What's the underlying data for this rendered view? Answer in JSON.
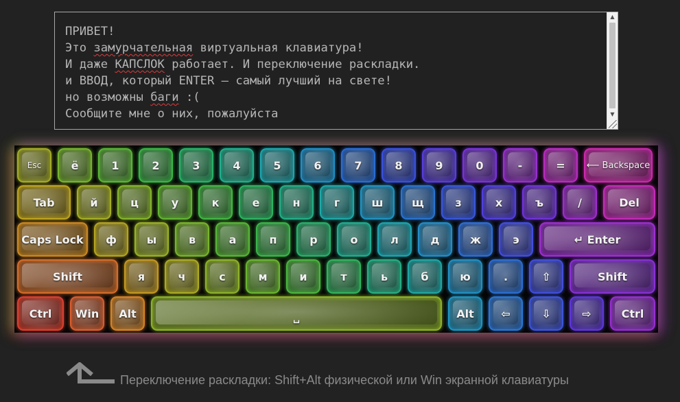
{
  "textarea": {
    "lines": [
      [
        {
          "t": "ПРИВЕТ!"
        }
      ],
      [
        {
          "t": "Это "
        },
        {
          "t": "замурчательная",
          "m": true
        },
        {
          "t": " виртуальная клавиатура!"
        }
      ],
      [
        {
          "t": "И даже "
        },
        {
          "t": "КАПСЛОК",
          "m": true
        },
        {
          "t": " работает. И переключение раскладки."
        }
      ],
      [
        {
          "t": "и ВВОД, который ENTER — самый лучший на свете!"
        }
      ],
      [
        {
          "t": "но возможны "
        },
        {
          "t": "баги",
          "m": true
        },
        {
          "t": " :("
        }
      ],
      [
        {
          "t": "Сообщите мне о них, пожалуйста"
        }
      ]
    ],
    "scroll_up_icon": "▲",
    "scroll_down_icon": "▼"
  },
  "keyboard": {
    "rows": [
      [
        {
          "label": "Esc",
          "name": "key-esc",
          "color": "#a8b028",
          "style": "small"
        },
        {
          "label": "ё",
          "name": "key-yo",
          "color": "#78b830"
        },
        {
          "label": "1",
          "name": "key-1",
          "color": "#5cb838"
        },
        {
          "label": "2",
          "name": "key-2",
          "color": "#3cb848"
        },
        {
          "label": "3",
          "name": "key-3",
          "color": "#2ab66a"
        },
        {
          "label": "4",
          "name": "key-4",
          "color": "#22b290"
        },
        {
          "label": "5",
          "name": "key-5",
          "color": "#1eaab0"
        },
        {
          "label": "6",
          "name": "key-6",
          "color": "#2090c8"
        },
        {
          "label": "7",
          "name": "key-7",
          "color": "#2a6ed8"
        },
        {
          "label": "8",
          "name": "key-8",
          "color": "#3a52e0"
        },
        {
          "label": "9",
          "name": "key-9",
          "color": "#5a3ee0"
        },
        {
          "label": "0",
          "name": "key-0",
          "color": "#7a34dc"
        },
        {
          "label": "-",
          "name": "key-minus",
          "color": "#9a30d4"
        },
        {
          "label": "=",
          "name": "key-equals",
          "color": "#bc2cc4"
        },
        {
          "label": "⟵ Backspace",
          "name": "key-backspace",
          "color": "#d02ab0",
          "style": "tiny"
        }
      ],
      [
        {
          "label": "Tab",
          "name": "key-tab",
          "color": "#c2a820"
        },
        {
          "label": "й",
          "name": "key-y-short",
          "color": "#a8b226"
        },
        {
          "label": "ц",
          "name": "key-ts",
          "color": "#86b82c"
        },
        {
          "label": "у",
          "name": "key-u",
          "color": "#64b834"
        },
        {
          "label": "к",
          "name": "key-k",
          "color": "#44b844"
        },
        {
          "label": "е",
          "name": "key-ye",
          "color": "#2eb662"
        },
        {
          "label": "н",
          "name": "key-n",
          "color": "#24b288"
        },
        {
          "label": "г",
          "name": "key-g",
          "color": "#1eacac"
        },
        {
          "label": "ш",
          "name": "key-sh",
          "color": "#2096c4"
        },
        {
          "label": "щ",
          "name": "key-shch",
          "color": "#2876d4"
        },
        {
          "label": "з",
          "name": "key-z",
          "color": "#3858de"
        },
        {
          "label": "х",
          "name": "key-kh",
          "color": "#5240e0"
        },
        {
          "label": "ъ",
          "name": "key-hard-sign",
          "color": "#7234dc"
        },
        {
          "label": "/",
          "name": "key-slash",
          "color": "#a02ed0"
        },
        {
          "label": "Del",
          "name": "key-del",
          "color": "#c82cbc"
        }
      ],
      [
        {
          "label": "Caps Lock",
          "name": "key-caps-lock",
          "color": "#d08c22"
        },
        {
          "label": "ф",
          "name": "key-f",
          "color": "#b8a822"
        },
        {
          "label": "ы",
          "name": "key-yery",
          "color": "#9cb428"
        },
        {
          "label": "в",
          "name": "key-v",
          "color": "#7ab82e"
        },
        {
          "label": "а",
          "name": "key-a",
          "color": "#58b838"
        },
        {
          "label": "п",
          "name": "key-p",
          "color": "#3cb84c"
        },
        {
          "label": "р",
          "name": "key-r",
          "color": "#2ab46e"
        },
        {
          "label": "о",
          "name": "key-o",
          "color": "#22b094"
        },
        {
          "label": "л",
          "name": "key-l",
          "color": "#1ea8b4"
        },
        {
          "label": "д",
          "name": "key-d",
          "color": "#2490ca"
        },
        {
          "label": "ж",
          "name": "key-zh",
          "color": "#3070d8"
        },
        {
          "label": "э",
          "name": "key-e",
          "color": "#4450e0"
        },
        {
          "label": "↵ Enter",
          "name": "key-enter",
          "color": "#a030d4"
        }
      ],
      [
        {
          "label": "Shift",
          "name": "key-shift-left",
          "color": "#d8702a"
        },
        {
          "label": "я",
          "name": "key-ya",
          "color": "#c89c22"
        },
        {
          "label": "ч",
          "name": "key-ch",
          "color": "#b0ae24"
        },
        {
          "label": "с",
          "name": "key-s",
          "color": "#90b62a"
        },
        {
          "label": "м",
          "name": "key-m",
          "color": "#6cb832"
        },
        {
          "label": "и",
          "name": "key-i",
          "color": "#4cb840"
        },
        {
          "label": "т",
          "name": "key-t",
          "color": "#32b660"
        },
        {
          "label": "ь",
          "name": "key-soft-sign",
          "color": "#26b286"
        },
        {
          "label": "б",
          "name": "key-b",
          "color": "#1eaaa8"
        },
        {
          "label": "ю",
          "name": "key-yu",
          "color": "#2292c6"
        },
        {
          "label": ".",
          "name": "key-period",
          "color": "#2c70d6"
        },
        {
          "label": "⇧",
          "name": "key-arrow-up",
          "color": "#4250e0"
        },
        {
          "label": "Shift",
          "name": "key-shift-right",
          "color": "#8a32d8"
        }
      ],
      [
        {
          "label": "Ctrl",
          "name": "key-ctrl-left",
          "color": "#e0402e"
        },
        {
          "label": "Win",
          "name": "key-win",
          "color": "#dc6030"
        },
        {
          "label": "Alt",
          "name": "key-alt-left",
          "color": "#d88628"
        },
        {
          "label": "␣",
          "name": "key-space",
          "color": "#90b62a"
        },
        {
          "label": "Alt",
          "name": "key-alt-right",
          "color": "#2098c4"
        },
        {
          "label": "⇦",
          "name": "key-arrow-left",
          "color": "#2c78d6"
        },
        {
          "label": "⇩",
          "name": "key-arrow-down",
          "color": "#3e56de"
        },
        {
          "label": "⇨",
          "name": "key-arrow-right",
          "color": "#6038de"
        },
        {
          "label": "Ctrl",
          "name": "key-ctrl-right",
          "color": "#9830d4"
        }
      ]
    ]
  },
  "hint": {
    "icon": "shift-layout-arrow-icon",
    "text": "Переключение раскладки: Shift+Alt физической или Win экранной клавиатуры"
  }
}
